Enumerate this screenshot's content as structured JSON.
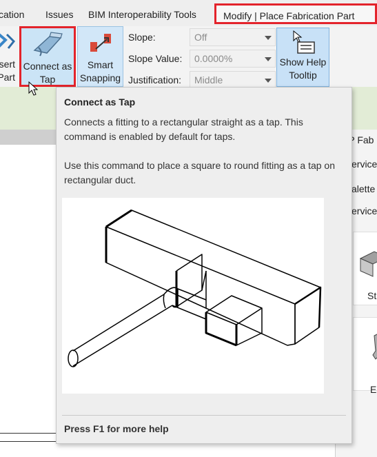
{
  "tabs": [
    {
      "label": "cation"
    },
    {
      "label": "Issues"
    },
    {
      "label": "BIM Interoperability Tools"
    },
    {
      "label": "Modify | Place Fabrication Part",
      "active": true
    }
  ],
  "ribbon": {
    "insert_part": {
      "line1": "sert",
      "line2": "Part"
    },
    "connect_as_tap": {
      "line1": "Connect as",
      "line2": "Tap"
    },
    "smart_snapping": {
      "line1": "Smart",
      "line2": "Snapping"
    },
    "slope": {
      "label": "Slope:",
      "value": "Off"
    },
    "slope_value": {
      "label": "Slope Value:",
      "value": "0.0000%"
    },
    "justification": {
      "label": "Justification:",
      "value": "Middle"
    },
    "show_help_tooltip": {
      "line1": "Show Help",
      "line2": "Tooltip"
    }
  },
  "tooltip": {
    "title": "Connect as Tap",
    "desc1": "Connects a fitting to a rectangular straight as a tap. This command is enabled by default for taps.",
    "desc2": "Use this command to place a square to round fitting as a tap on rectangular duct.",
    "footer": "Press F1 for more help"
  },
  "right_panel": {
    "title": "EP Fab",
    "service": "ervice",
    "palettes": "alette",
    "service2": "ervice",
    "tile1_label": "Str",
    "tile2_label": "E"
  },
  "colors": {
    "highlight_border": "#e3232b",
    "ribbon_bg": "#f3f3f3",
    "ribbon_panel_green": "#e2ecd6",
    "button_active": "#cbe4f6"
  },
  "icons": [
    "insert-part-icon",
    "connect-as-tap-icon",
    "smart-snapping-icon",
    "show-help-tooltip-icon",
    "mouse-cursor-icon",
    "dropdown-arrow-icon"
  ]
}
